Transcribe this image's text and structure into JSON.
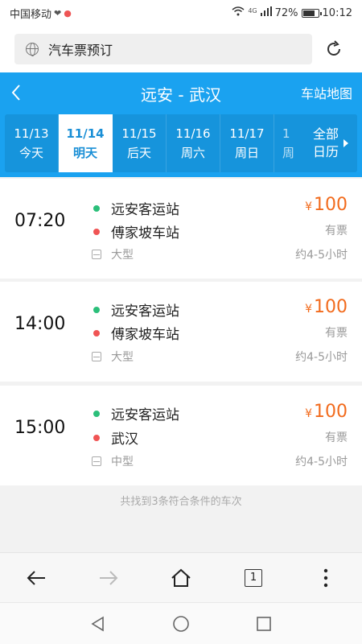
{
  "status_bar": {
    "carrier": "中国移动",
    "network": "4G",
    "battery": "72%",
    "time": "10:12"
  },
  "url_bar": {
    "title": "汽车票预订",
    "left_icon": "globe-icon",
    "right_icon": "reload-icon"
  },
  "header": {
    "route": "远安 - 武汉",
    "map_link": "车站地图",
    "back_icon": "back-chevron-icon"
  },
  "date_tabs": [
    {
      "date": "11/13",
      "label": "今天",
      "active": false
    },
    {
      "date": "11/14",
      "label": "明天",
      "active": true
    },
    {
      "date": "11/15",
      "label": "后天",
      "active": false
    },
    {
      "date": "11/16",
      "label": "周六",
      "active": false
    },
    {
      "date": "11/17",
      "label": "周日",
      "active": false
    }
  ],
  "partial_tab": {
    "date": "1",
    "label": "周"
  },
  "calendar_button": {
    "line1": "全部",
    "line2": "日历"
  },
  "tickets": [
    {
      "time": "07:20",
      "from": "远安客运站",
      "to": "傅家坡车站",
      "bus_type": "大型",
      "currency": "¥",
      "price": "100",
      "availability": "有票",
      "duration": "约4-5小时"
    },
    {
      "time": "14:00",
      "from": "远安客运站",
      "to": "傅家坡车站",
      "bus_type": "大型",
      "currency": "¥",
      "price": "100",
      "availability": "有票",
      "duration": "约4-5小时"
    },
    {
      "time": "15:00",
      "from": "远安客运站",
      "to": "武汉",
      "bus_type": "中型",
      "currency": "¥",
      "price": "100",
      "availability": "有票",
      "duration": "约4-5小时"
    }
  ],
  "result_note": "共找到3条符合条件的车次",
  "browser_toolbar": {
    "tab_count": "1"
  },
  "colors": {
    "header_blue": "#1aa2f0",
    "price_orange": "#f26b1d",
    "origin_dot": "#2bbf7a",
    "destination_dot": "#f05454"
  }
}
